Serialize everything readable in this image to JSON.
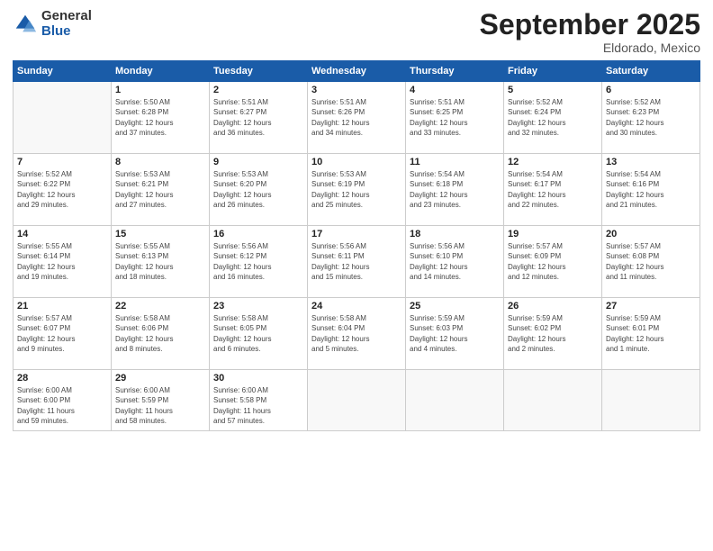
{
  "logo": {
    "general": "General",
    "blue": "Blue"
  },
  "header": {
    "month": "September 2025",
    "location": "Eldorado, Mexico"
  },
  "weekdays": [
    "Sunday",
    "Monday",
    "Tuesday",
    "Wednesday",
    "Thursday",
    "Friday",
    "Saturday"
  ],
  "weeks": [
    [
      {
        "day": "",
        "info": ""
      },
      {
        "day": "1",
        "info": "Sunrise: 5:50 AM\nSunset: 6:28 PM\nDaylight: 12 hours\nand 37 minutes."
      },
      {
        "day": "2",
        "info": "Sunrise: 5:51 AM\nSunset: 6:27 PM\nDaylight: 12 hours\nand 36 minutes."
      },
      {
        "day": "3",
        "info": "Sunrise: 5:51 AM\nSunset: 6:26 PM\nDaylight: 12 hours\nand 34 minutes."
      },
      {
        "day": "4",
        "info": "Sunrise: 5:51 AM\nSunset: 6:25 PM\nDaylight: 12 hours\nand 33 minutes."
      },
      {
        "day": "5",
        "info": "Sunrise: 5:52 AM\nSunset: 6:24 PM\nDaylight: 12 hours\nand 32 minutes."
      },
      {
        "day": "6",
        "info": "Sunrise: 5:52 AM\nSunset: 6:23 PM\nDaylight: 12 hours\nand 30 minutes."
      }
    ],
    [
      {
        "day": "7",
        "info": "Sunrise: 5:52 AM\nSunset: 6:22 PM\nDaylight: 12 hours\nand 29 minutes."
      },
      {
        "day": "8",
        "info": "Sunrise: 5:53 AM\nSunset: 6:21 PM\nDaylight: 12 hours\nand 27 minutes."
      },
      {
        "day": "9",
        "info": "Sunrise: 5:53 AM\nSunset: 6:20 PM\nDaylight: 12 hours\nand 26 minutes."
      },
      {
        "day": "10",
        "info": "Sunrise: 5:53 AM\nSunset: 6:19 PM\nDaylight: 12 hours\nand 25 minutes."
      },
      {
        "day": "11",
        "info": "Sunrise: 5:54 AM\nSunset: 6:18 PM\nDaylight: 12 hours\nand 23 minutes."
      },
      {
        "day": "12",
        "info": "Sunrise: 5:54 AM\nSunset: 6:17 PM\nDaylight: 12 hours\nand 22 minutes."
      },
      {
        "day": "13",
        "info": "Sunrise: 5:54 AM\nSunset: 6:16 PM\nDaylight: 12 hours\nand 21 minutes."
      }
    ],
    [
      {
        "day": "14",
        "info": "Sunrise: 5:55 AM\nSunset: 6:14 PM\nDaylight: 12 hours\nand 19 minutes."
      },
      {
        "day": "15",
        "info": "Sunrise: 5:55 AM\nSunset: 6:13 PM\nDaylight: 12 hours\nand 18 minutes."
      },
      {
        "day": "16",
        "info": "Sunrise: 5:56 AM\nSunset: 6:12 PM\nDaylight: 12 hours\nand 16 minutes."
      },
      {
        "day": "17",
        "info": "Sunrise: 5:56 AM\nSunset: 6:11 PM\nDaylight: 12 hours\nand 15 minutes."
      },
      {
        "day": "18",
        "info": "Sunrise: 5:56 AM\nSunset: 6:10 PM\nDaylight: 12 hours\nand 14 minutes."
      },
      {
        "day": "19",
        "info": "Sunrise: 5:57 AM\nSunset: 6:09 PM\nDaylight: 12 hours\nand 12 minutes."
      },
      {
        "day": "20",
        "info": "Sunrise: 5:57 AM\nSunset: 6:08 PM\nDaylight: 12 hours\nand 11 minutes."
      }
    ],
    [
      {
        "day": "21",
        "info": "Sunrise: 5:57 AM\nSunset: 6:07 PM\nDaylight: 12 hours\nand 9 minutes."
      },
      {
        "day": "22",
        "info": "Sunrise: 5:58 AM\nSunset: 6:06 PM\nDaylight: 12 hours\nand 8 minutes."
      },
      {
        "day": "23",
        "info": "Sunrise: 5:58 AM\nSunset: 6:05 PM\nDaylight: 12 hours\nand 6 minutes."
      },
      {
        "day": "24",
        "info": "Sunrise: 5:58 AM\nSunset: 6:04 PM\nDaylight: 12 hours\nand 5 minutes."
      },
      {
        "day": "25",
        "info": "Sunrise: 5:59 AM\nSunset: 6:03 PM\nDaylight: 12 hours\nand 4 minutes."
      },
      {
        "day": "26",
        "info": "Sunrise: 5:59 AM\nSunset: 6:02 PM\nDaylight: 12 hours\nand 2 minutes."
      },
      {
        "day": "27",
        "info": "Sunrise: 5:59 AM\nSunset: 6:01 PM\nDaylight: 12 hours\nand 1 minute."
      }
    ],
    [
      {
        "day": "28",
        "info": "Sunrise: 6:00 AM\nSunset: 6:00 PM\nDaylight: 11 hours\nand 59 minutes."
      },
      {
        "day": "29",
        "info": "Sunrise: 6:00 AM\nSunset: 5:59 PM\nDaylight: 11 hours\nand 58 minutes."
      },
      {
        "day": "30",
        "info": "Sunrise: 6:00 AM\nSunset: 5:58 PM\nDaylight: 11 hours\nand 57 minutes."
      },
      {
        "day": "",
        "info": ""
      },
      {
        "day": "",
        "info": ""
      },
      {
        "day": "",
        "info": ""
      },
      {
        "day": "",
        "info": ""
      }
    ]
  ]
}
